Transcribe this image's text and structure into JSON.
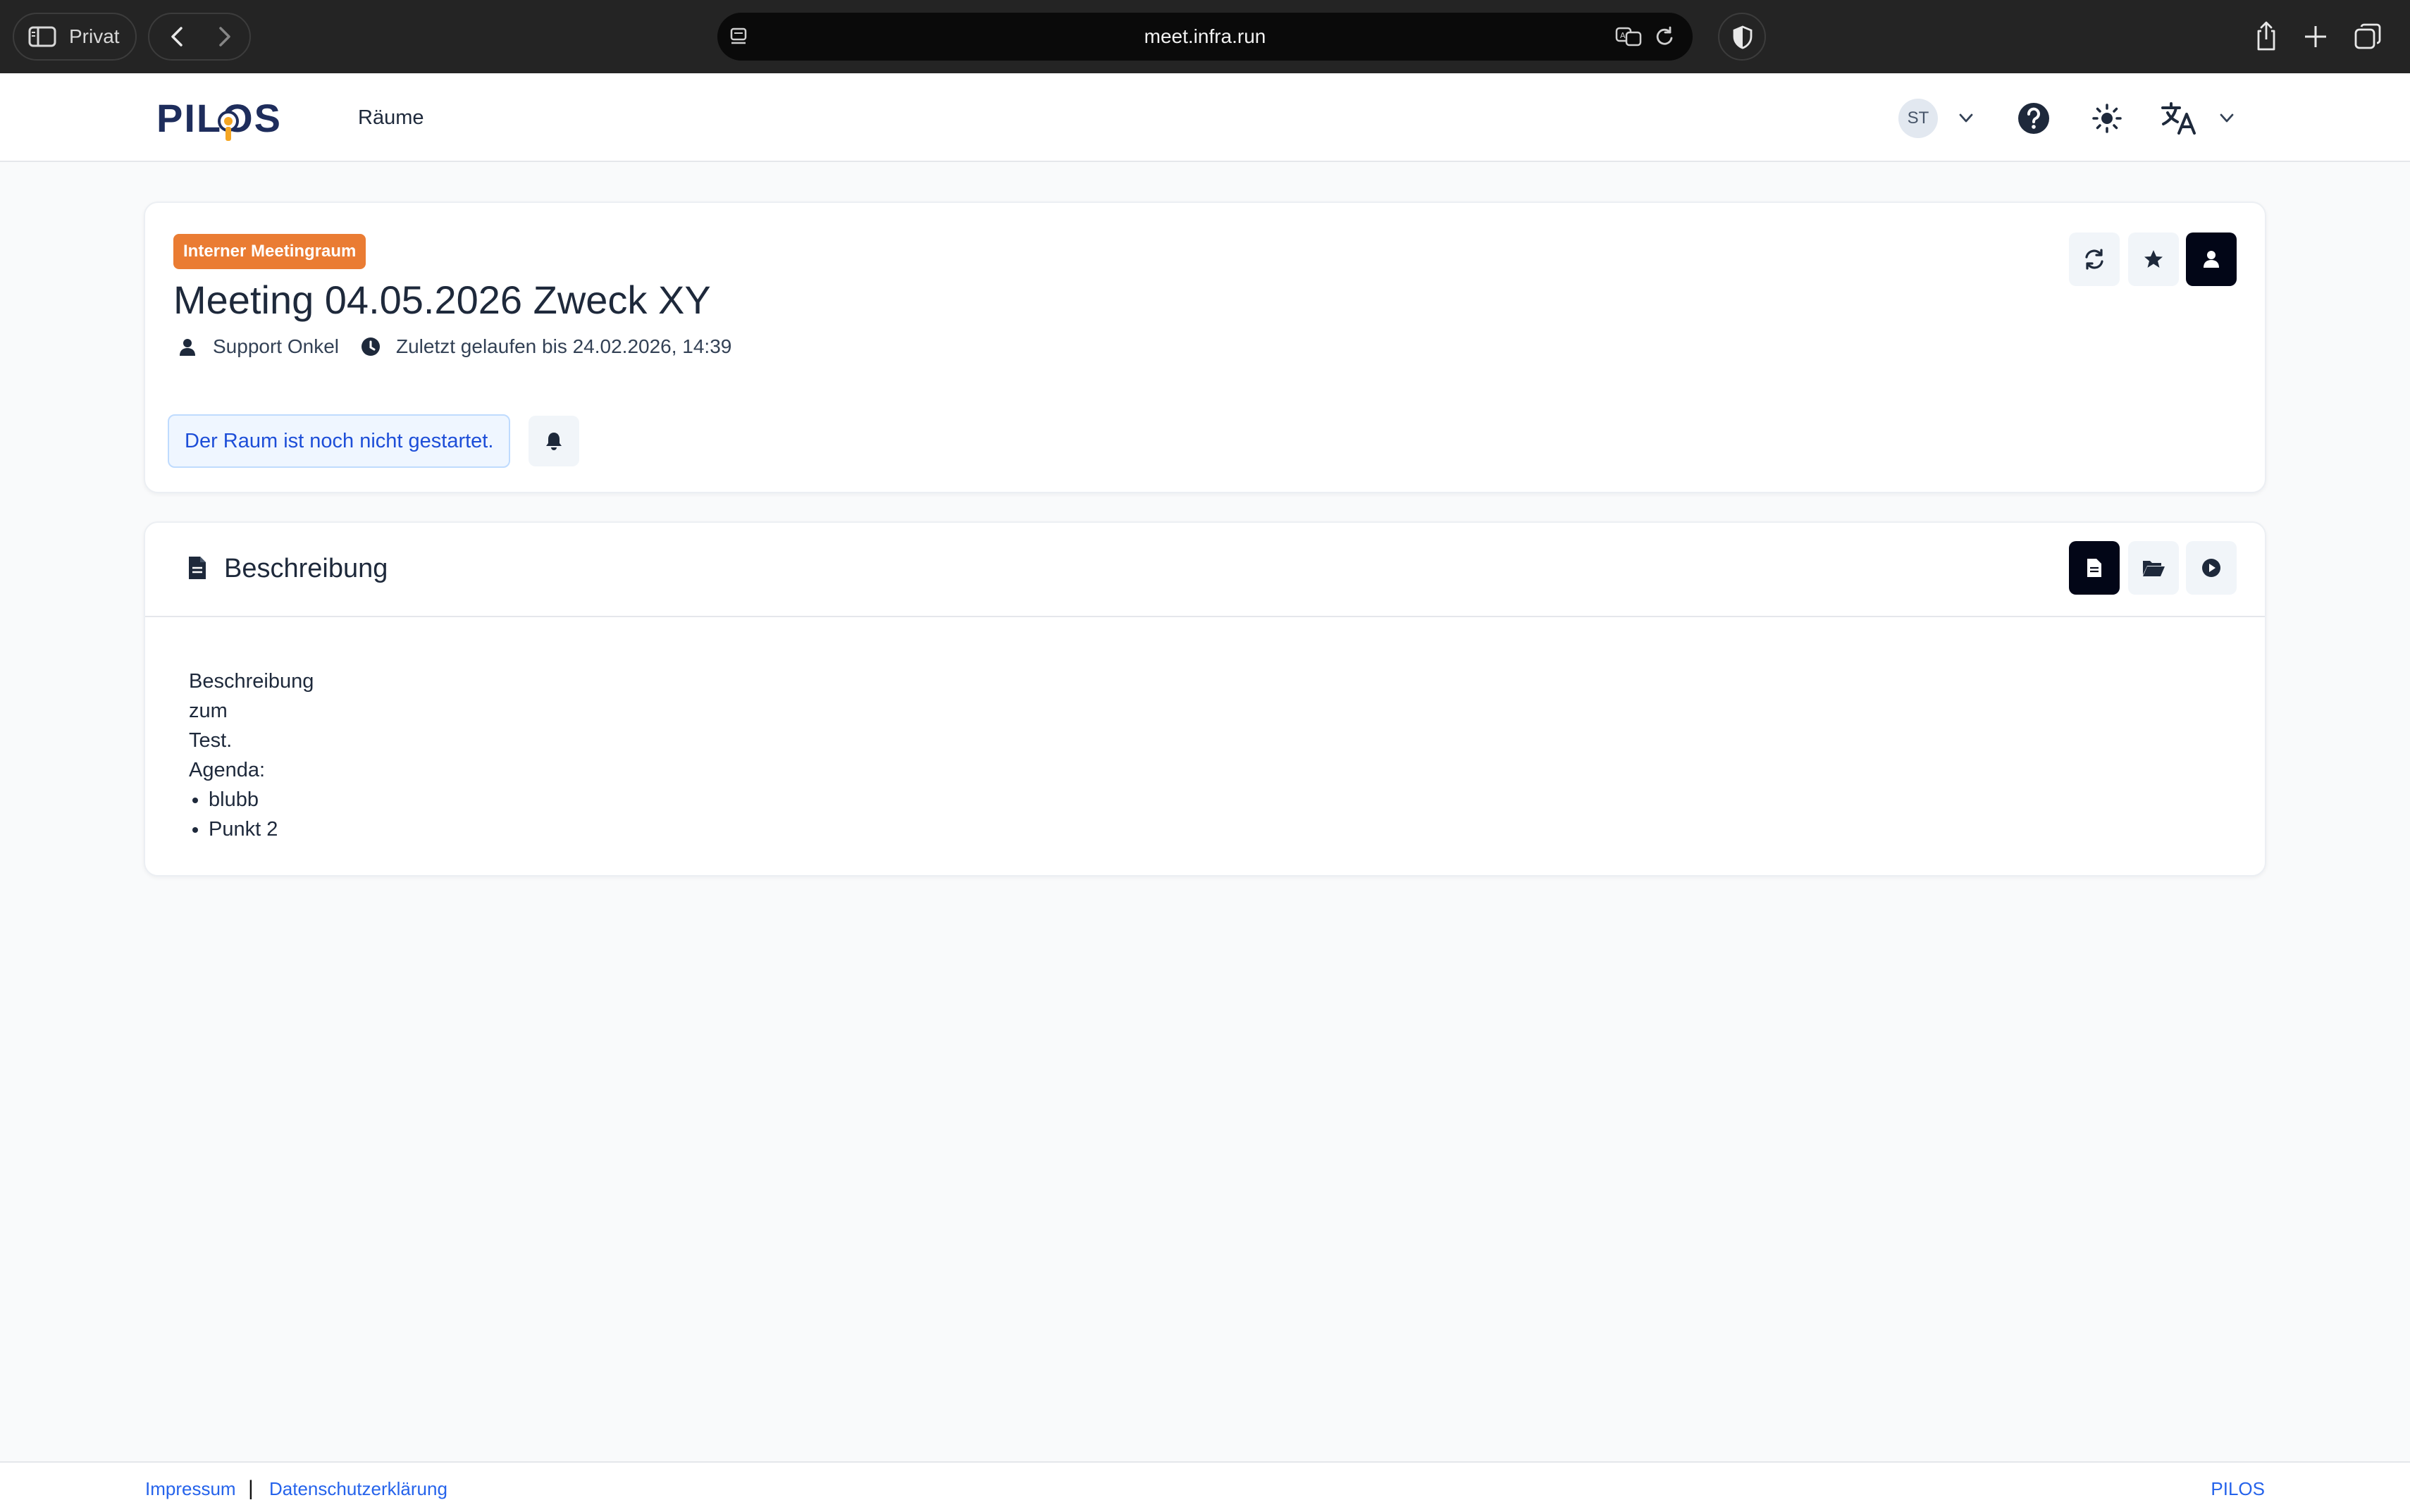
{
  "browser": {
    "privat_label": "Privat",
    "url": "meet.infra.run"
  },
  "header": {
    "logo_text": "PILOS",
    "nav_rooms": "Räume",
    "avatar_initials": "ST"
  },
  "room": {
    "badge": "Interner Meetingraum",
    "title": "Meeting 04.05.2026 Zweck XY",
    "owner": "Support Onkel",
    "last_run": "Zuletzt gelaufen bis 24.02.2026, 14:39",
    "status": "Der Raum ist noch nicht gestartet."
  },
  "description": {
    "heading": "Beschreibung",
    "lines": [
      "Beschreibung",
      "zum",
      "Test.",
      "Agenda:"
    ],
    "agenda": [
      "blubb",
      "Punkt 2"
    ]
  },
  "footer": {
    "imprint": "Impressum",
    "separator": "|",
    "privacy": "Datenschutzerklärung",
    "brand": "PILOS"
  },
  "colors": {
    "badge_orange": "#ea7c33",
    "status_blue": "#1d4ed8",
    "link_blue": "#2563eb",
    "brand_navy": "#1e2d5c",
    "logo_accent": "#f5a623"
  }
}
